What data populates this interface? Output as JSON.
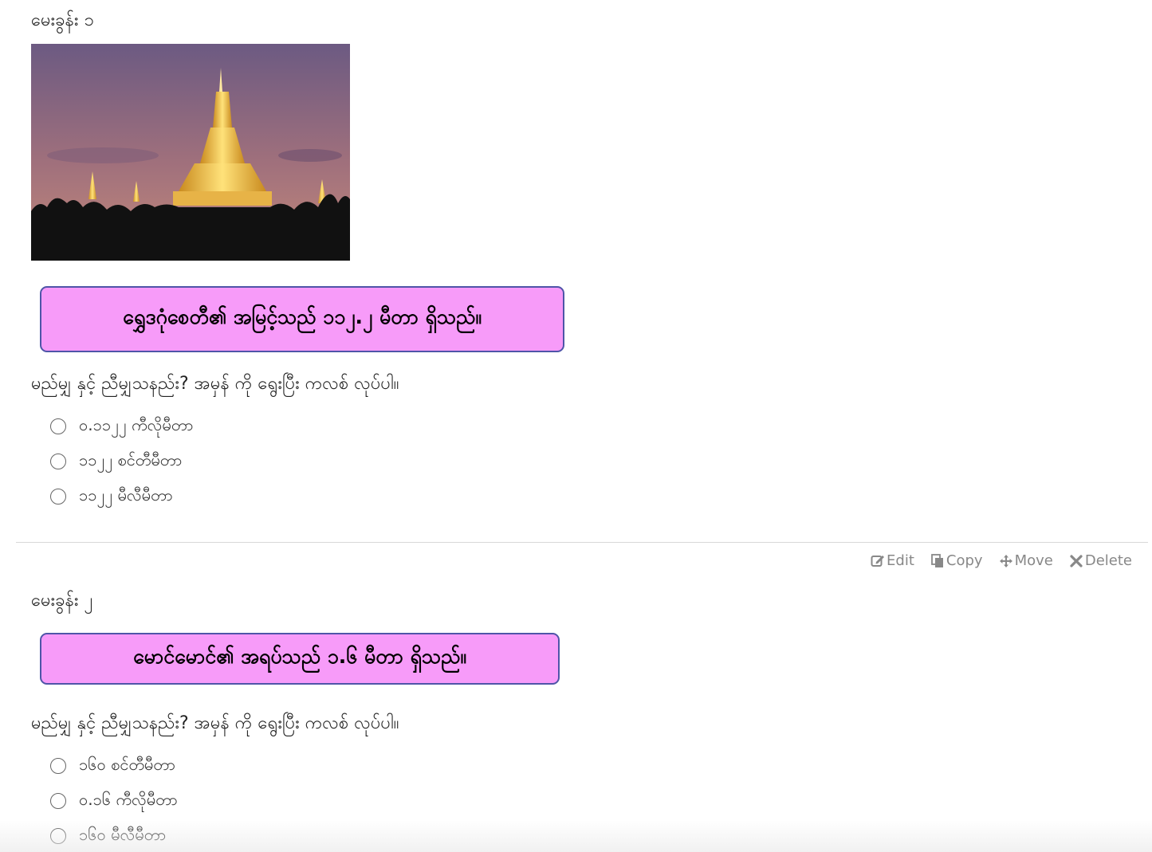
{
  "questions": [
    {
      "title": "မေးခွန်း ၁",
      "statement": "ရွှေဒဂုံစေတီ၏ အမြင့်သည် ၁၁၂.၂ မီတာ ရှိသည်။",
      "prompt": "မည်မျှ နှင့် ညီမျှသနည်း? အမှန် ကို ရွေးပြီး ကလစ် လုပ်ပါ။",
      "options": [
        "၀.၁၁၂၂ ကီလိုမီတာ",
        "၁၁၂၂ စင်တီမီတာ",
        "၁၁၂၂ မီလီမီတာ"
      ]
    },
    {
      "title": "မေးခွန်း ၂",
      "statement": "မောင်မောင်၏ အရပ်သည် ၁.၆ မီတာ ရှိသည်။",
      "prompt": "မည်မျှ နှင့် ညီမျှသနည်း? အမှန် ကို ရွေးပြီး ကလစ် လုပ်ပါ။",
      "options": [
        "၁၆၀ စင်တီမီတာ",
        "၀.၁၆ ကီလိုမီတာ",
        "၁၆၀ မီလီမီတာ"
      ]
    }
  ],
  "toolbar": {
    "edit": "Edit",
    "copy": "Copy",
    "move": "Move",
    "delete": "Delete"
  },
  "icons": {
    "edit": "edit-icon",
    "copy": "copy-icon",
    "move": "move-icon",
    "delete": "close-icon",
    "radio": "radio-button"
  },
  "colors": {
    "statement_bg": "#f79bf9",
    "statement_border": "#4f55a8",
    "toolbar_text": "#888888"
  }
}
